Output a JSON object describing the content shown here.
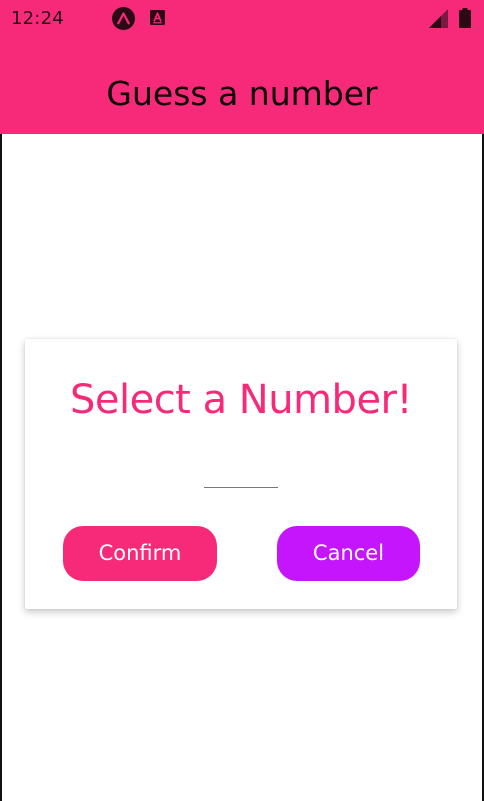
{
  "status_bar": {
    "time": "12:24",
    "icons": [
      "expo-icon",
      "a-square-icon",
      "signal-icon",
      "battery-icon"
    ]
  },
  "header": {
    "title": "Guess a number"
  },
  "card": {
    "title": "Select a Number!",
    "input": {
      "value": "",
      "placeholder": ""
    },
    "confirm_label": "Confirm",
    "cancel_label": "Cancel"
  },
  "colors": {
    "primary": "#f72a7a",
    "accent": "#c415fc",
    "background": "#ffffff"
  }
}
